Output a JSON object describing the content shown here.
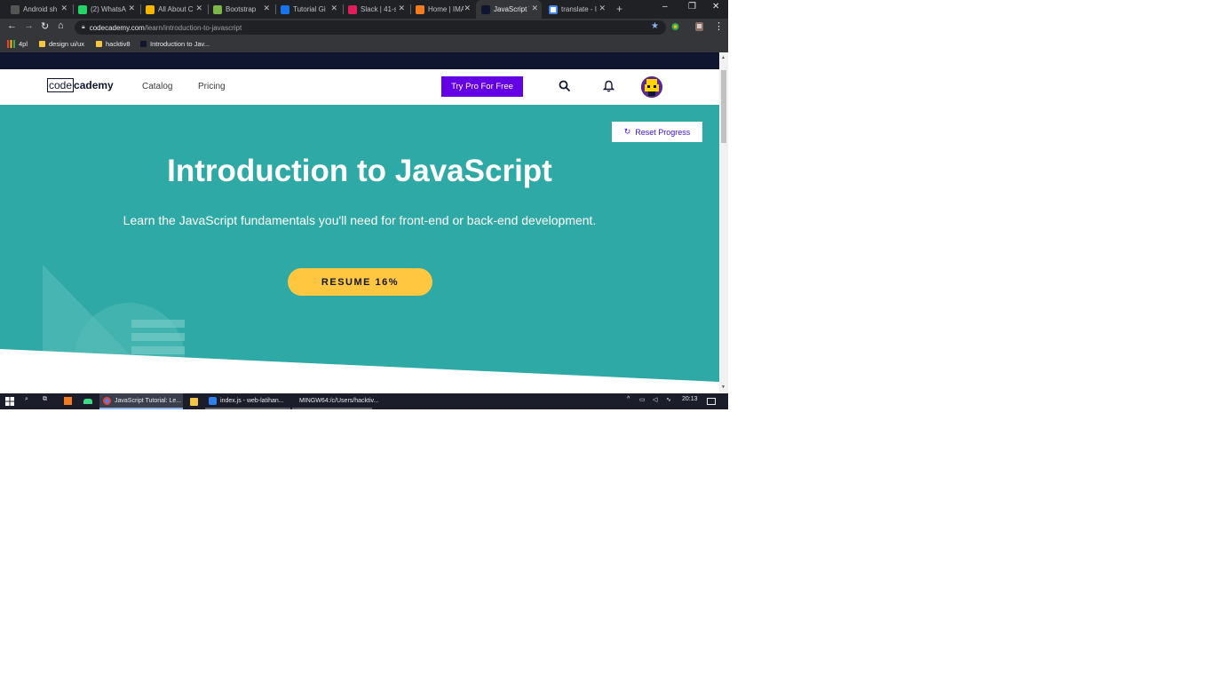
{
  "browser": {
    "tabs": [
      {
        "title": "Android sh",
        "color": "#333333"
      },
      {
        "title": "(2) WhatsA",
        "color": "#25d366"
      },
      {
        "title": "All About C",
        "color": "#f4b400"
      },
      {
        "title": "Bootstrap",
        "color": "#7952b3"
      },
      {
        "title": "Tutorial Gi",
        "color": "#1a73e8"
      },
      {
        "title": "Slack | 41-s",
        "color": "#e01e5a"
      },
      {
        "title": "Home | IMA",
        "color": "#f47c20"
      },
      {
        "title": "JavaScript T",
        "color": "#10162f"
      },
      {
        "title": "translate - I",
        "color": "#4285f4"
      }
    ],
    "new_tab": "+",
    "window_controls": {
      "minimize": "–",
      "maximize": "❐",
      "close": "✕"
    },
    "url_host": "codecademy.com",
    "url_path": "/learn/introduction-to-javascript",
    "bookmarks": [
      {
        "label": "4pl",
        "kind": "apps"
      },
      {
        "label": "design ui/ux",
        "kind": "folder"
      },
      {
        "label": "hacktiv8",
        "kind": "folder"
      },
      {
        "label": "Introduction to Jav...",
        "kind": "page"
      }
    ]
  },
  "navbar": {
    "logo_code": "code",
    "logo_rest": "cademy",
    "links": [
      "Catalog",
      "Pricing"
    ],
    "try_pro": "Try Pro For Free"
  },
  "hero": {
    "reset_label": "Reset Progress",
    "title": "Introduction to JavaScript",
    "subtitle": "Learn the JavaScript fundamentals you'll need for front-end or back-end development.",
    "resume_label": "RESUME 16%",
    "progress": 0.16,
    "colors": {
      "hero_bg": "#2ea9a5",
      "resume_bg": "#ffc740",
      "pro_bg": "#6400e4"
    }
  },
  "taskbar": {
    "apps": [
      {
        "label": "JavaScript Tutorial: Le...",
        "active": true,
        "color": "#4285f4"
      },
      {
        "label": "",
        "active": false,
        "color": "#f3c744"
      },
      {
        "label": "index.js - web-latihan...",
        "active": false,
        "color": "#2f80ed"
      },
      {
        "label": "MINGW64:/c/Users/hacktiv...",
        "active": false,
        "color": "#6a9fb5"
      }
    ],
    "time": "20:13"
  }
}
